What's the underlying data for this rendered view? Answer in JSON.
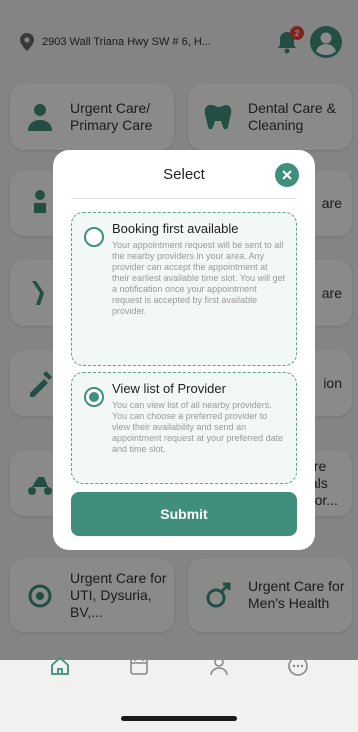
{
  "header": {
    "address": "2903 Wall Triana Hwy SW # 6, H...",
    "notification_count": "2"
  },
  "cards": [
    {
      "label": "Urgent Care/ Primary Care",
      "icon": "doctor-icon"
    },
    {
      "label": "Dental Care & Cleaning",
      "icon": "tooth-icon"
    },
    {
      "label": "",
      "icon": "baby-icon"
    },
    {
      "label": "are",
      "icon": "generic-icon"
    },
    {
      "label": "",
      "icon": "joint-icon"
    },
    {
      "label": "are",
      "icon": "generic-icon"
    },
    {
      "label": "",
      "icon": "syringe-icon"
    },
    {
      "label": "ion",
      "icon": "generic-icon"
    },
    {
      "label": "",
      "icon": "scooter-icon"
    },
    {
      "label": "are tals Vor...",
      "icon": "generic-icon"
    },
    {
      "label": "Urgent Care for UTI, Dysuria, BV,...",
      "icon": "female-icon"
    },
    {
      "label": "Urgent Care for Men's Health",
      "icon": "male-icon"
    }
  ],
  "modal": {
    "title": "Select",
    "options": [
      {
        "title": "Booking first available",
        "description": "Your appointment request will be sent to all the nearby providers in your area. Any provider can accept the appointment at their earliest available time slot. You will get a notification once your appointment request is accepted by first available provider.",
        "selected": false
      },
      {
        "title": "View list of Provider",
        "description": "You can view list of all nearby providers. You can choose a preferred provider to view their availability and send an appointment request at your preferred date and time slot.",
        "selected": true
      }
    ],
    "submit_label": "Submit"
  },
  "nav": [
    "home-icon",
    "calendar-icon",
    "profile-icon",
    "more-icon"
  ],
  "colors": {
    "accent": "#3f8f7c",
    "badge": "#e3453a"
  }
}
